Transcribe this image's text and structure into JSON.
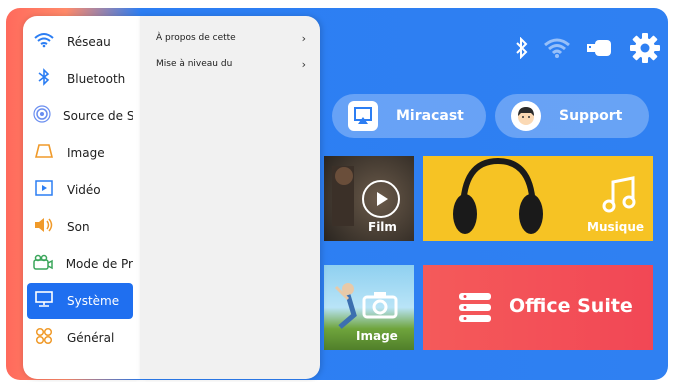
{
  "status_icons": [
    "bluetooth-icon",
    "wifi-icon",
    "usb-drive-icon",
    "gear-icon"
  ],
  "shortcuts": [
    {
      "label": "Miracast",
      "icon": "cast-icon"
    },
    {
      "label": "Support",
      "icon": "support-face-icon"
    }
  ],
  "tiles": {
    "film": "Film",
    "music": "Musique",
    "image": "Image",
    "office": "Office Suite"
  },
  "sidebar": {
    "items": [
      {
        "label": "Réseau",
        "icon": "wifi-icon"
      },
      {
        "label": "Bluetooth",
        "icon": "bluetooth-icon"
      },
      {
        "label": "Source de S",
        "icon": "signal-source-icon"
      },
      {
        "label": "Image",
        "icon": "trapezoid-icon"
      },
      {
        "label": "Vidéo",
        "icon": "video-play-icon"
      },
      {
        "label": "Son",
        "icon": "speaker-icon"
      },
      {
        "label": "Mode de Pr",
        "icon": "projector-icon"
      },
      {
        "label": "Système",
        "icon": "monitor-icon"
      },
      {
        "label": "Général",
        "icon": "general-settings-icon"
      }
    ],
    "active_index": 7
  },
  "submenu": {
    "items": [
      {
        "label": "À propos de cette"
      },
      {
        "label": "Mise à niveau du"
      }
    ]
  },
  "colors": {
    "accent": "#1f6ff0",
    "background": "#2f80f2",
    "music_tile": "#f6c324",
    "office_tile": "#f24755"
  }
}
